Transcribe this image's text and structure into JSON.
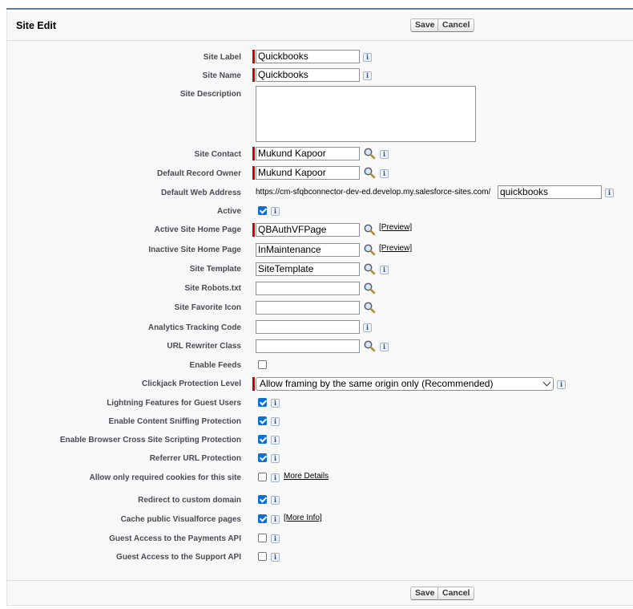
{
  "page": {
    "title": "Site Edit",
    "save_label": "Save",
    "cancel_label": "Cancel"
  },
  "fields": {
    "site_label": {
      "label": "Site Label",
      "value": "Quickbooks"
    },
    "site_name": {
      "label": "Site Name",
      "value": "Quickbooks"
    },
    "site_description": {
      "label": "Site Description",
      "value": ""
    },
    "site_contact": {
      "label": "Site Contact",
      "value": "Mukund Kapoor"
    },
    "default_record_owner": {
      "label": "Default Record Owner",
      "value": "Mukund Kapoor"
    },
    "default_web_address": {
      "label": "Default Web Address",
      "prefix": "https://cm-sfqbconnector-dev-ed.develop.my.salesforce-sites.com/",
      "value": "quickbooks"
    },
    "active": {
      "label": "Active",
      "checked": true
    },
    "active_home_page": {
      "label": "Active Site Home Page",
      "value": "QBAuthVFPage",
      "preview": "[Preview]"
    },
    "inactive_home_page": {
      "label": "Inactive Site Home Page",
      "value": "InMaintenance",
      "preview": "[Preview]"
    },
    "site_template": {
      "label": "Site Template",
      "value": "SiteTemplate"
    },
    "site_robots": {
      "label": "Site Robots.txt",
      "value": ""
    },
    "site_favicon": {
      "label": "Site Favorite Icon",
      "value": ""
    },
    "analytics_code": {
      "label": "Analytics Tracking Code",
      "value": ""
    },
    "url_rewriter": {
      "label": "URL Rewriter Class",
      "value": ""
    },
    "enable_feeds": {
      "label": "Enable Feeds",
      "checked": false
    },
    "clickjack": {
      "label": "Clickjack Protection Level",
      "value": "Allow framing by the same origin only (Recommended)"
    },
    "lightning_guest": {
      "label": "Lightning Features for Guest Users",
      "checked": true
    },
    "content_sniffing": {
      "label": "Enable Content Sniffing Protection",
      "checked": true
    },
    "xss_protection": {
      "label": "Enable Browser Cross Site Scripting Protection",
      "checked": true
    },
    "referrer_protection": {
      "label": "Referrer URL Protection",
      "checked": true
    },
    "required_cookies": {
      "label": "Allow only required cookies for this site",
      "checked": false,
      "link": "More Details"
    },
    "redirect_custom_domain": {
      "label": "Redirect to custom domain",
      "checked": true
    },
    "cache_vf_pages": {
      "label": "Cache public Visualforce pages",
      "checked": true,
      "link": "[More Info]"
    },
    "guest_payments_api": {
      "label": "Guest Access to the Payments API",
      "checked": false
    },
    "guest_support_api": {
      "label": "Guest Access to the Support API",
      "checked": false
    }
  },
  "icons": {
    "info": "i",
    "lookup": "magnifier-icon"
  }
}
